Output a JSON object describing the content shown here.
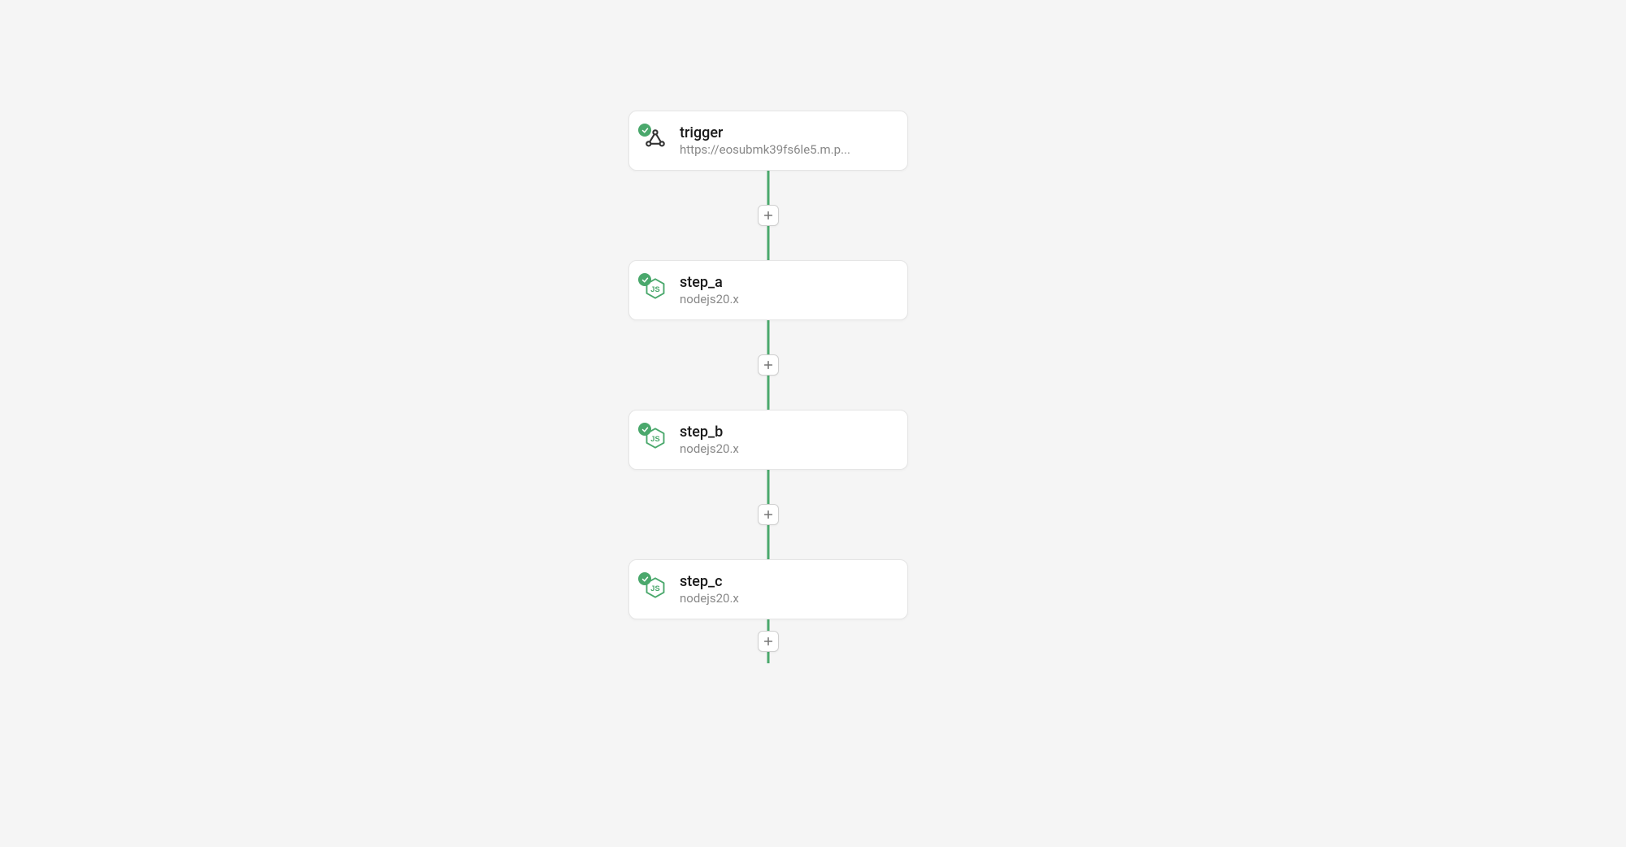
{
  "nodes": [
    {
      "title": "trigger",
      "subtitle": "https://eosubmk39fs6le5.m.p...",
      "icon_type": "webhook",
      "status": "success"
    },
    {
      "title": "step_a",
      "subtitle": "nodejs20.x",
      "icon_type": "nodejs",
      "status": "success"
    },
    {
      "title": "step_b",
      "subtitle": "nodejs20.x",
      "icon_type": "nodejs",
      "status": "success"
    },
    {
      "title": "step_c",
      "subtitle": "nodejs20.x",
      "icon_type": "nodejs",
      "status": "success"
    }
  ],
  "colors": {
    "connector": "#4aa86c",
    "status_success": "#4aa86c",
    "nodejs": "#4aa86c",
    "webhook": "#333333"
  }
}
